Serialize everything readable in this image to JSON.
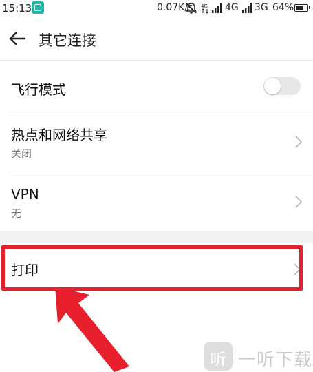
{
  "status_bar": {
    "time": "15:13",
    "net_speed": "0.07K/s",
    "net1": "4G",
    "net2": "3G",
    "battery": "64%"
  },
  "header": {
    "title": "其它连接"
  },
  "settings": {
    "airplane": {
      "label": "飞行模式",
      "enabled": false
    },
    "hotspot": {
      "label": "热点和网络共享",
      "status": "关闭"
    },
    "vpn": {
      "label": "VPN",
      "status": "无"
    },
    "print": {
      "label": "打印"
    }
  },
  "watermark": {
    "logo_char": "听",
    "text": "一听下载"
  },
  "colors": {
    "highlight": "#e8202e",
    "screen_icon": "#21b8a8",
    "toggle_off": "#e8e8e8"
  },
  "icons": [
    "screen-capture-icon",
    "bell-off-icon",
    "signal-icon",
    "battery-icon",
    "back-arrow-icon",
    "chevron-right-icon"
  ]
}
